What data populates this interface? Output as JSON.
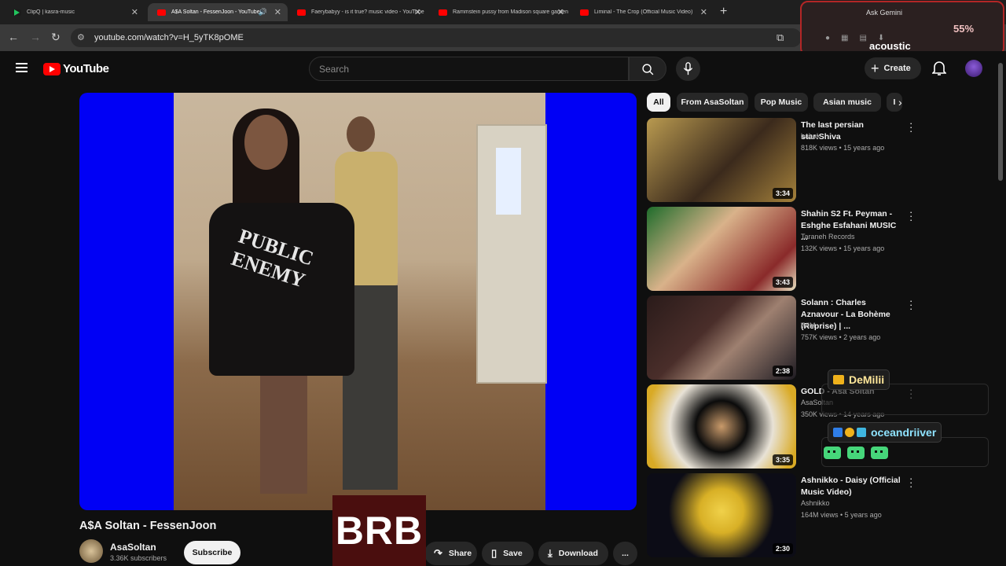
{
  "browser": {
    "tabs": [
      {
        "title": "ClipQ | kasra-music",
        "icon": "play-icon"
      },
      {
        "title": "A$A Soltan - FessenJoon - YouTube",
        "icon": "youtube-icon"
      },
      {
        "title": "Faerybabyy - is it true? music video - YouTube",
        "icon": "youtube-icon"
      },
      {
        "title": "Rammstein pussy from Madison square garden",
        "icon": "youtube-icon"
      },
      {
        "title": "Liminal - The Crop (Official Music Video)",
        "icon": "youtube-icon"
      }
    ],
    "new_tab": "+",
    "url": "youtube.com/watch?v=H_5yTK8pOME"
  },
  "stream_widget": {
    "gemini": "Ask Gemini",
    "percent": "55%",
    "label": "acoustic"
  },
  "header": {
    "logo": "YouTube",
    "search_placeholder": "Search",
    "create_label": "Create"
  },
  "chips": [
    "All",
    "From AsaSoltan",
    "Pop Music",
    "Asian music",
    "I"
  ],
  "recommendations": [
    {
      "title": "The last persian star:Shiva",
      "channel": "babak",
      "meta": "818K views • 15 years ago",
      "duration": "3:34"
    },
    {
      "title": "Shahin S2 Ft. Peyman - Eshghe Esfahani MUSIC ...",
      "channel": "Taraneh Records",
      "meta": "132K views • 15 years ago",
      "duration": "3:43"
    },
    {
      "title": "Solann : Charles Aznavour - La Bohème (Reprise) | ...",
      "channel": "WIM",
      "meta": "757K views • 2 years ago",
      "duration": "2:38"
    },
    {
      "title": "GOLD - Asa Soltan",
      "channel": "AsaSoltan",
      "meta": "350K views • 14 years ago",
      "duration": "3:35"
    },
    {
      "title": "Ashnikko - Daisy (Official Music Video)",
      "channel": "Ashnikko",
      "meta": "164M views • 5 years ago",
      "duration": "2:30"
    }
  ],
  "video": {
    "title": "A$A Soltan - FessenJoon",
    "shirt_text": "PUBLIC ENEMY"
  },
  "channel": {
    "name": "AsaSoltan",
    "subscribers": "3.36K subscribers",
    "subscribe_label": "Subscribe"
  },
  "actions": {
    "share": "Share",
    "save": "Save",
    "download": "Download",
    "more": "..."
  },
  "brb": "BRB",
  "chat": {
    "user1": "DeMilii",
    "user2": "oceandriiver"
  }
}
